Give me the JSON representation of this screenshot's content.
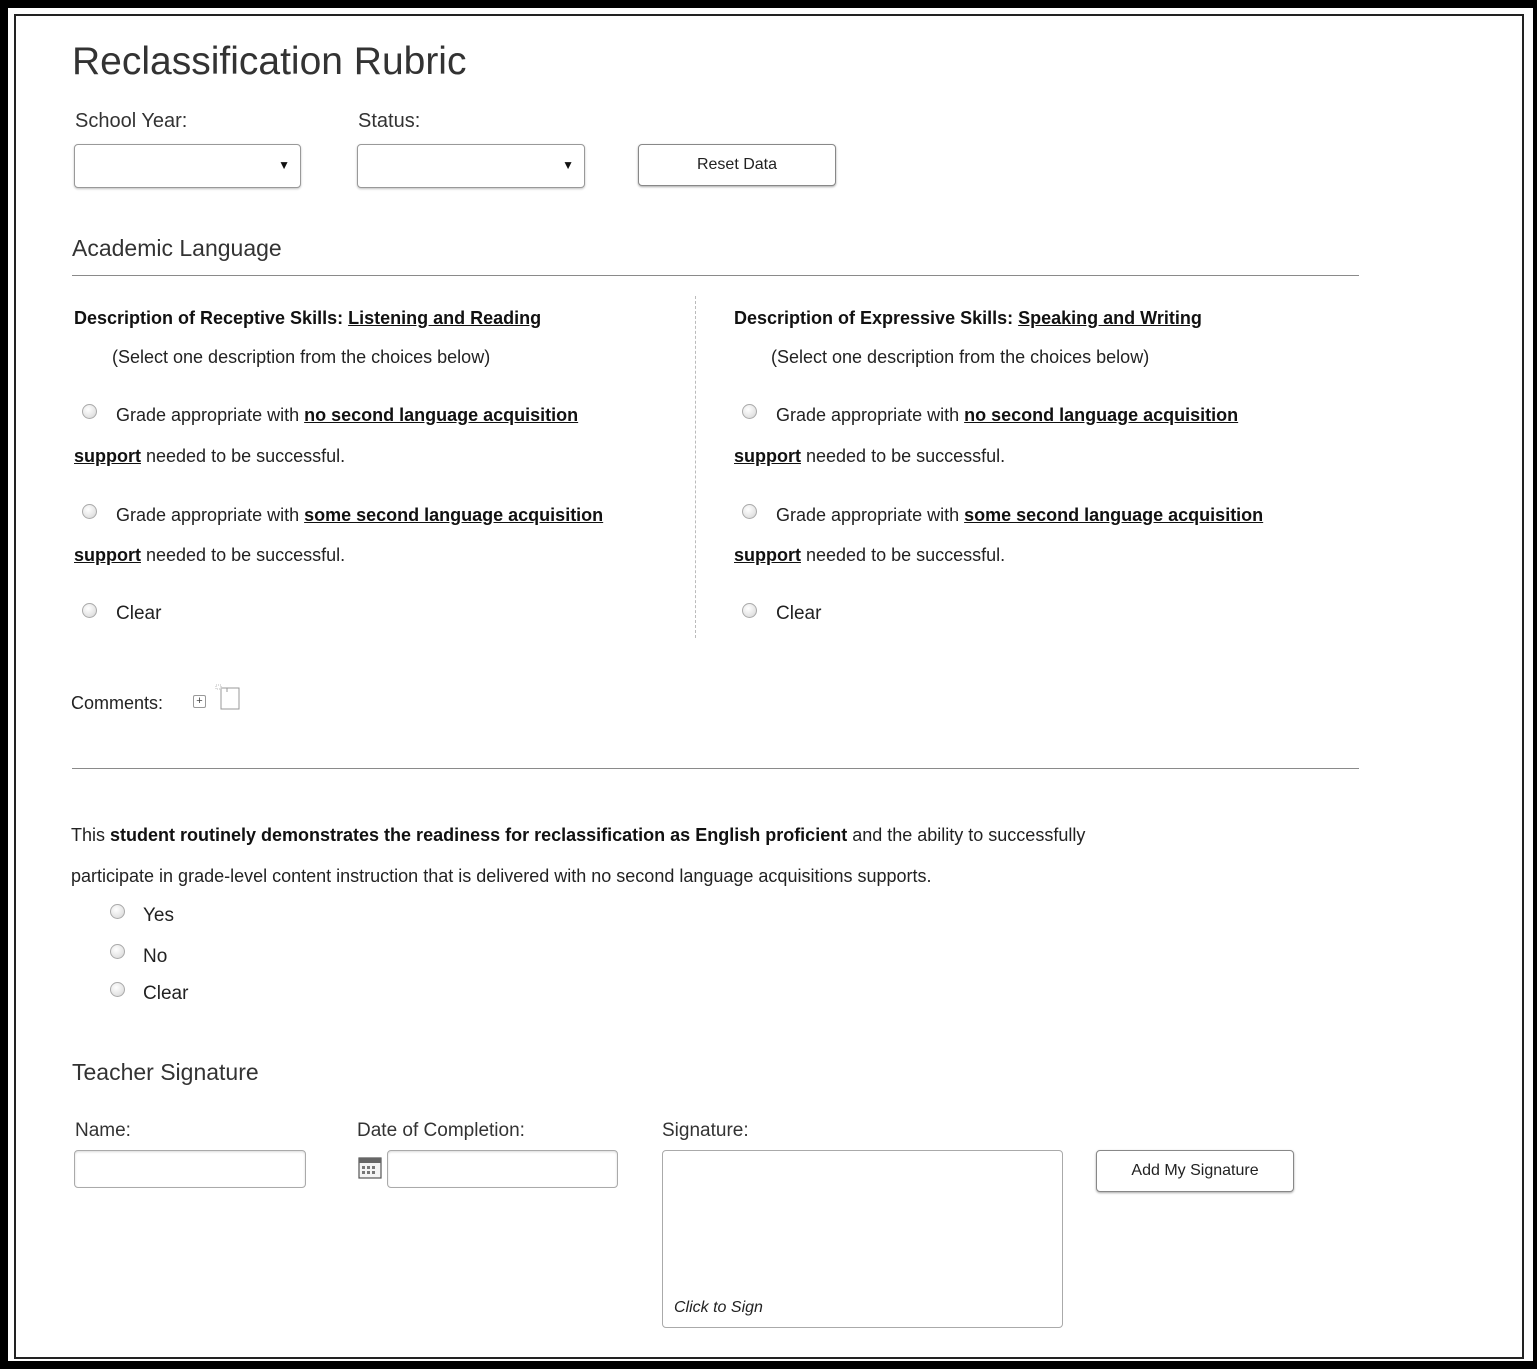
{
  "page": {
    "title": "Reclassification Rubric"
  },
  "filters": {
    "school_year_label": "School Year:",
    "school_year_value": "",
    "status_label": "Status:",
    "status_value": "",
    "reset_button": "Reset Data"
  },
  "academic_language": {
    "heading": "Academic Language",
    "receptive": {
      "head_prefix": "Description of Receptive Skills:",
      "head_link": "Listening and Reading",
      "hint": "(Select one description from the choices below)",
      "options": [
        {
          "pre": "Grade appropriate with ",
          "bold1": "no second language acquisition",
          "bold2": "support",
          "post": " needed to be successful."
        },
        {
          "pre": "Grade appropriate with ",
          "bold1": "some second language acquisition",
          "bold2": "support",
          "post": " needed to be successful."
        }
      ],
      "clear_label": "Clear"
    },
    "expressive": {
      "head_prefix": "Description of Expressive Skills:",
      "head_link": "Speaking and Writing",
      "hint": "(Select one description from the choices below)",
      "options": [
        {
          "pre": "Grade appropriate with ",
          "bold1": "no second language acquisition",
          "bold2": "support",
          "post": " needed to be successful."
        },
        {
          "pre": "Grade appropriate with ",
          "bold1": "some second language acquisition",
          "bold2": "support",
          "post": " needed to be successful."
        }
      ],
      "clear_label": "Clear"
    },
    "comments_label": "Comments:"
  },
  "readiness": {
    "line1_pre": "This ",
    "line1_bold": "student routinely demonstrates the readiness for reclassification as English proficient",
    "line1_post": " and the ability to successfully",
    "line2": "participate in grade-level content instruction that is delivered with no second language acquisitions supports.",
    "options": [
      "Yes",
      "No",
      "Clear"
    ]
  },
  "signature": {
    "heading": "Teacher Signature",
    "name_label": "Name:",
    "name_value": "",
    "date_label": "Date of Completion:",
    "date_value": "",
    "signature_label": "Signature:",
    "click_to_sign": "Click to Sign",
    "add_button": "Add My Signature"
  },
  "icons": {
    "dropdown": "caret-down-icon",
    "expand": "plus-box-icon",
    "note": "note-icon",
    "calendar": "calendar-icon"
  }
}
